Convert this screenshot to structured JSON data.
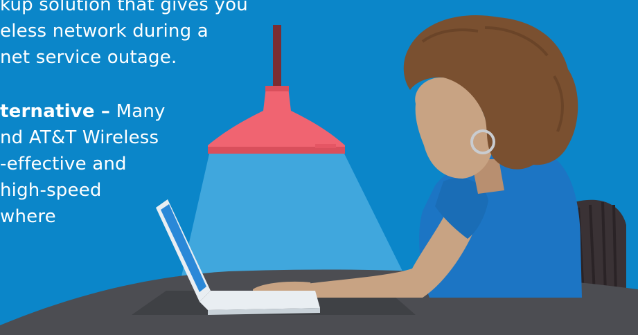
{
  "text": {
    "line1": "kup solution that gives you",
    "line2": "eless network during a",
    "line3": "net service outage.",
    "line4_bold": "ternative –",
    "line4_rest": " Many",
    "line5": "nd AT&T Wireless",
    "line6": "-effective and",
    "line7": " high-speed",
    "line8": "where"
  },
  "colors": {
    "background": "#0b86c9",
    "lampShade": "#f06471",
    "lampShadeDark": "#d94f5c",
    "lightBeam": "#6ec3ec",
    "tableTop": "#4c4d52",
    "tableShadow": "#3b3c40",
    "hair": "#7a5030",
    "skin": "#c8a383",
    "shirt": "#1c75c4",
    "chair": "#3a3235",
    "laptop": "#e9eef2",
    "laptopScreen": "#2a88d8"
  },
  "icons": {
    "lamp": "pendant-lamp-illustration",
    "person": "woman-using-laptop-illustration",
    "laptop": "laptop-illustration"
  }
}
